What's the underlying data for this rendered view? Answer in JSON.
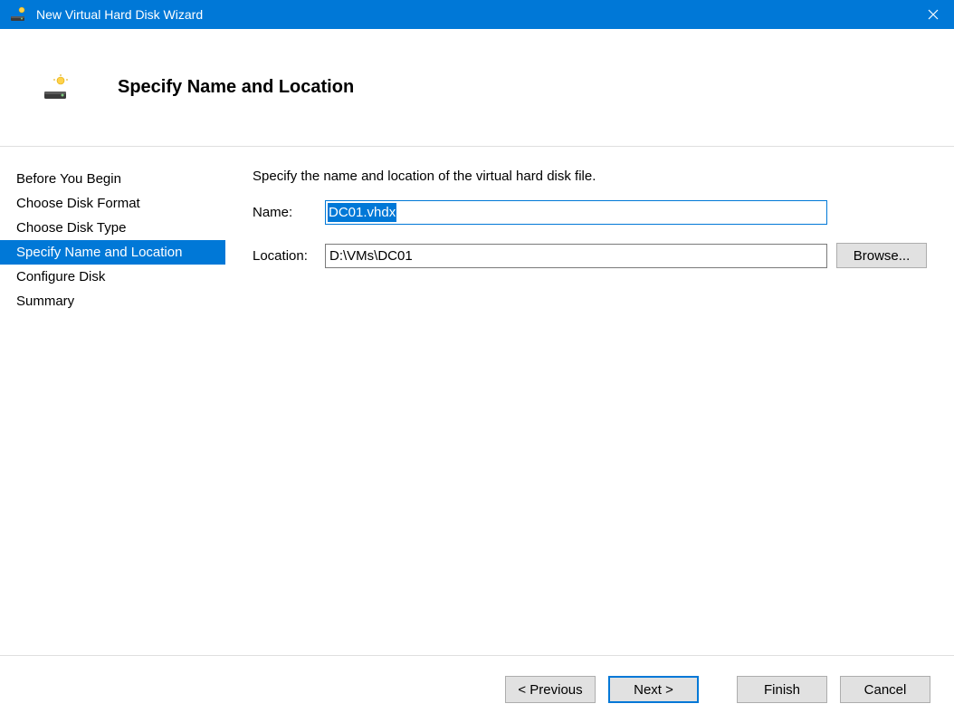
{
  "window": {
    "title": "New Virtual Hard Disk Wizard"
  },
  "header": {
    "title": "Specify Name and Location"
  },
  "sidebar": {
    "items": [
      {
        "label": "Before You Begin",
        "selected": false
      },
      {
        "label": "Choose Disk Format",
        "selected": false
      },
      {
        "label": "Choose Disk Type",
        "selected": false
      },
      {
        "label": "Specify Name and Location",
        "selected": true
      },
      {
        "label": "Configure Disk",
        "selected": false
      },
      {
        "label": "Summary",
        "selected": false
      }
    ]
  },
  "content": {
    "instruction": "Specify the name and location of the virtual hard disk file.",
    "name_label": "Name:",
    "name_value": "DC01.vhdx",
    "location_label": "Location:",
    "location_value": "D:\\VMs\\DC01",
    "browse_label": "Browse..."
  },
  "footer": {
    "previous_label": "< Previous",
    "next_label": "Next >",
    "finish_label": "Finish",
    "cancel_label": "Cancel"
  }
}
